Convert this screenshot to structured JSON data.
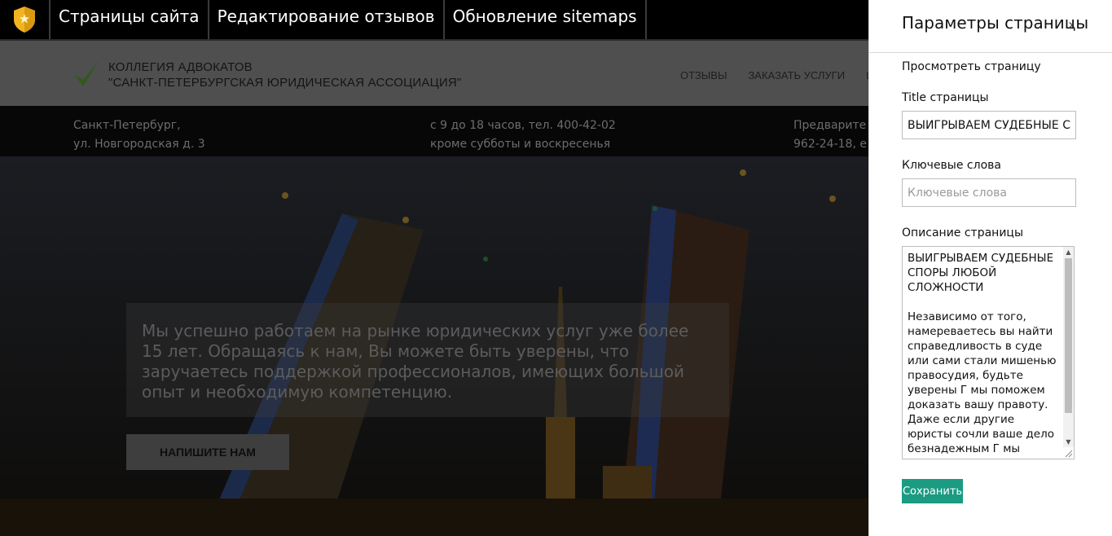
{
  "admin_bar": {
    "tabs": [
      "Страницы сайта",
      "Редактирование отзывов",
      "Обновление sitemaps"
    ]
  },
  "site": {
    "college_line1": "КОЛЛЕГИЯ АДВОКАТОВ",
    "college_line2": "\"САНКТ-ПЕТЕРБУРГСКАЯ ЮРИДИЧЕСКАЯ АССОЦИАЦИЯ\"",
    "nav": [
      "ОТЗЫВЫ",
      "ЗАКАЗАТЬ УСЛУГИ",
      "ЦЕ"
    ],
    "contacts": {
      "address_line1": "Санкт-Петербург,",
      "address_line2": "ул. Новгородская д. 3",
      "hours_line1": "с 9 до 18 часов, тел. 400-42-02",
      "hours_line2": "кроме субботы и воскресенья",
      "pre_line1": "Предварите",
      "pre_line2": "962-24-18, е"
    },
    "hero_text": "Мы успешно работаем на рынке юридических услуг уже более 15 лет. Обращаясь к нам, Вы можете быть уверены, что заручаетесь поддержкой профессионалов, имеющих большой опыт и необходимую компетенцию.",
    "hero_button": "НАПИШИТЕ НАМ"
  },
  "panel": {
    "title": "Параметры страницы",
    "chevron": "›",
    "view_link": "Просмотреть страницу",
    "title_label": "Title страницы",
    "title_value": "ВЫИГРЫВАЕМ СУДЕБНЫЕ СПОРЫ ЛЮБОЙ СЛОЖНОСТИ",
    "keywords_label": "Ключевые слова",
    "keywords_placeholder": "Ключевые слова",
    "keywords_value": "",
    "description_label": "Описание страницы",
    "description_value": "ВЫИГРЫВАЕМ СУДЕБНЫЕ СПОРЫ ЛЮБОЙ СЛОЖНОСТИ\n\nНезависимо от того, намереваетесь вы найти справедливость в суде или сами стали мишенью правосудия, будьте уверены Г мы поможем доказать вашу правоту. Даже если другие юристы сочли ваше дело безнадежным Г мы",
    "save_button": "Сохранить"
  },
  "colors": {
    "accent": "#1a9b82",
    "logo_shield": "#f2b320"
  }
}
